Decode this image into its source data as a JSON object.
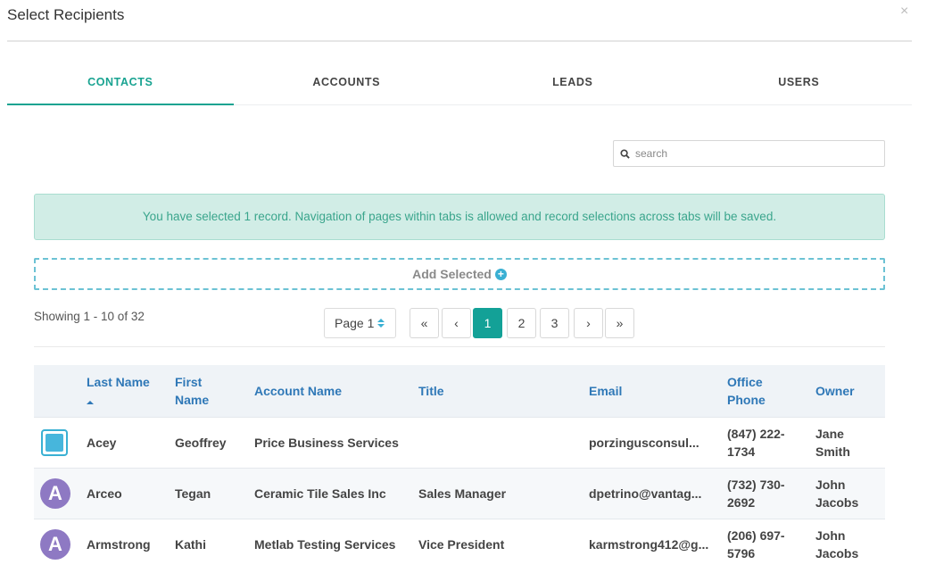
{
  "dialog": {
    "title": "Select Recipients",
    "close_glyph": "×"
  },
  "tabs": [
    {
      "label": "CONTACTS",
      "active": true
    },
    {
      "label": "ACCOUNTS",
      "active": false
    },
    {
      "label": "LEADS",
      "active": false
    },
    {
      "label": "USERS",
      "active": false
    }
  ],
  "search": {
    "placeholder": "search",
    "value": ""
  },
  "alert": {
    "text": "You have selected 1 record. Navigation of pages within tabs is allowed and record selections across tabs will be saved."
  },
  "add_selected": {
    "label": "Add Selected",
    "icon": "plus-circle-icon"
  },
  "pagination": {
    "showing": "Showing 1 - 10 of 32",
    "page_select": "Page 1",
    "first": "«",
    "prev": "‹",
    "pages": [
      "1",
      "2",
      "3"
    ],
    "current_page": "1",
    "next": "›",
    "last": "»"
  },
  "table": {
    "headers": {
      "last_name": "Last Name",
      "first_name": "First Name",
      "account_name": "Account Name",
      "title": "Title",
      "email": "Email",
      "office_phone": "Office Phone",
      "owner": "Owner"
    },
    "rows": [
      {
        "selected": true,
        "avatar": "",
        "last_name": "Acey",
        "first_name": "Geoffrey",
        "account_name": "Price Business Services",
        "title": "",
        "email": "porzingusconsul...",
        "office_phone": "(847) 222-1734",
        "owner": "Jane Smith"
      },
      {
        "selected": false,
        "avatar": "A",
        "last_name": "Arceo",
        "first_name": "Tegan",
        "account_name": "Ceramic Tile Sales Inc",
        "title": "Sales Manager",
        "email": "dpetrino@vantag...",
        "office_phone": "(732) 730-2692",
        "owner": "John Jacobs"
      },
      {
        "selected": false,
        "avatar": "A",
        "last_name": "Armstrong",
        "first_name": "Kathi",
        "account_name": "Metlab Testing Services",
        "title": "Vice President",
        "email": "karmstrong412@g...",
        "office_phone": "(206) 697-5796",
        "owner": "John Jacobs"
      }
    ]
  },
  "colors": {
    "accent": "#19a391",
    "link": "#2f78b7",
    "avatar": "#8e79c3",
    "checkbox": "#3ab0d3",
    "alert_bg": "#d1ede6"
  }
}
